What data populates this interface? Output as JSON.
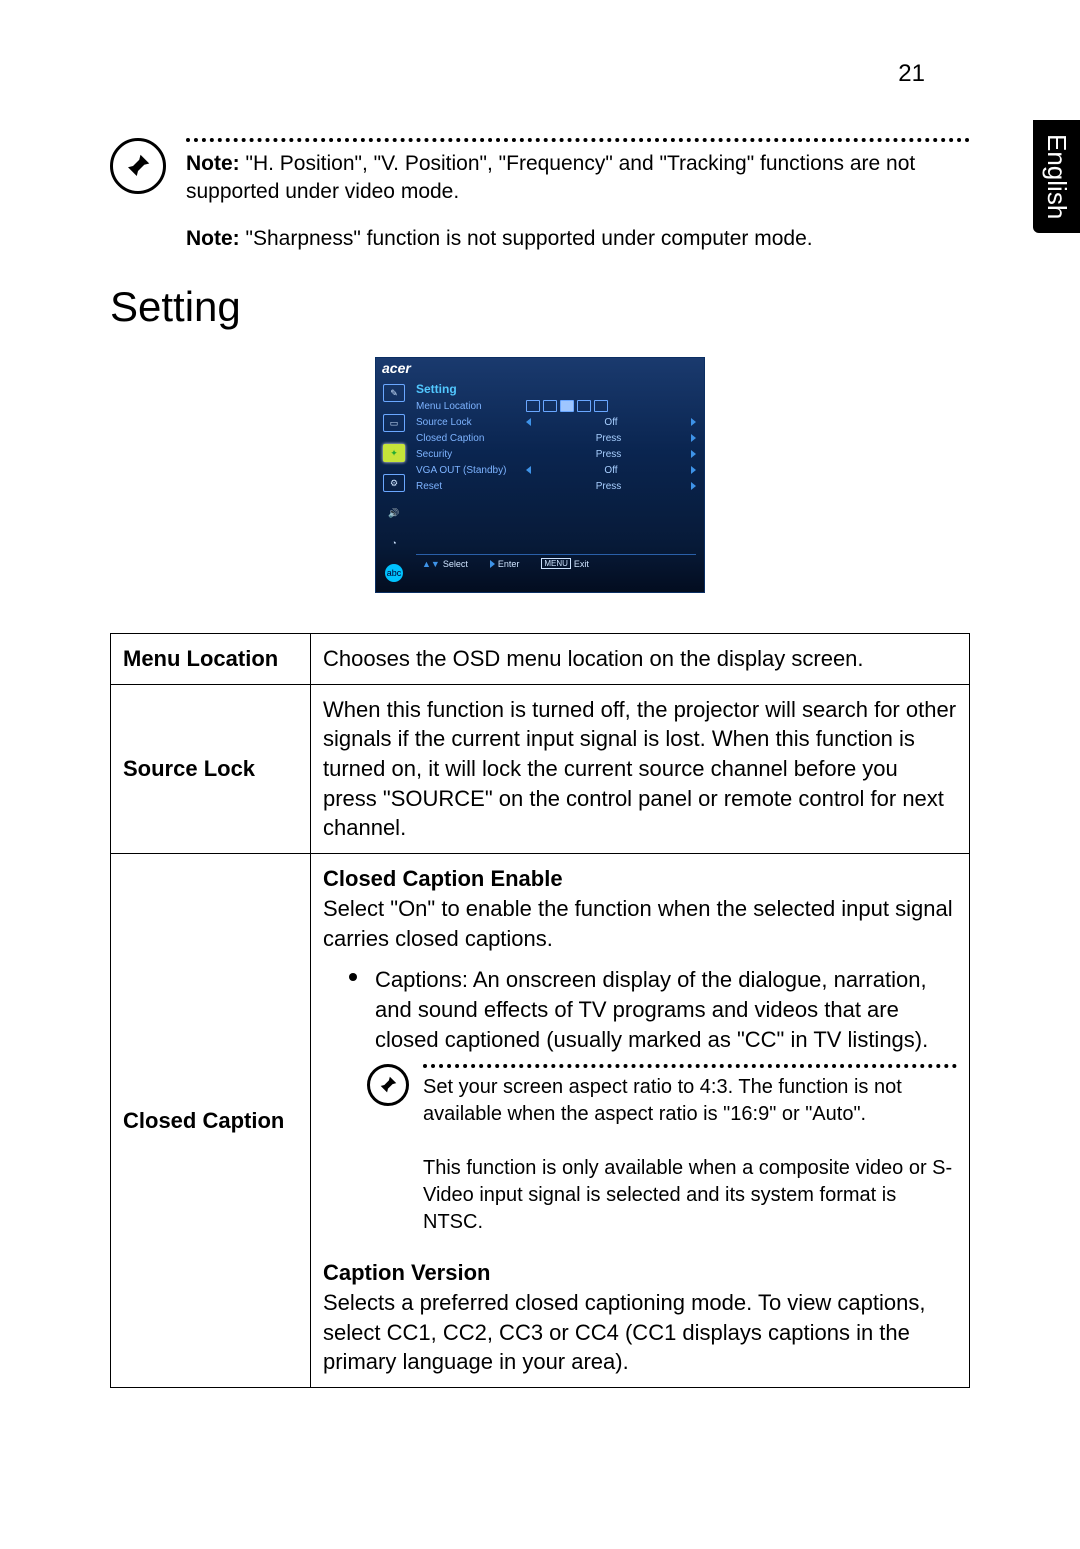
{
  "page_number": "21",
  "language_tab": "English",
  "notes": {
    "note1_bold": "Note:",
    "note1_text": " \"H. Position\", \"V. Position\", \"Frequency\" and \"Tracking\" functions are not supported under video mode.",
    "note2_bold": "Note:",
    "note2_text": " \"Sharpness\" function is not supported under computer mode."
  },
  "section_title": "Setting",
  "osd": {
    "logo": "acer",
    "heading": "Setting",
    "rows": [
      {
        "label": "Menu Location",
        "value": ""
      },
      {
        "label": "Source Lock",
        "value": "Off"
      },
      {
        "label": "Closed Caption",
        "value": "Press"
      },
      {
        "label": "Security",
        "value": "Press"
      },
      {
        "label": "VGA OUT (Standby)",
        "value": "Off"
      },
      {
        "label": "Reset",
        "value": "Press"
      }
    ],
    "footer": {
      "select": "Select",
      "enter": "Enter",
      "menu": "MENU",
      "exit": "Exit"
    }
  },
  "table": {
    "menu_location": {
      "label": "Menu Location",
      "desc": "Chooses the OSD menu location on the display screen."
    },
    "source_lock": {
      "label": "Source Lock",
      "desc": "When this function is turned off, the projector will search for other signals if the current input signal is lost. When this function is turned on, it will lock the current source channel before you press \"SOURCE\" on the control panel or remote control for next channel."
    },
    "closed_caption": {
      "label": "Closed Caption",
      "cc_enable_title": "Closed Caption Enable",
      "cc_enable_desc": "Select \"On\" to enable the function when the selected input signal carries closed captions.",
      "bullet": "Captions: An onscreen display of the dialogue, narration, and sound effects of TV programs and videos that are closed captioned (usually marked as \"CC\" in TV listings).",
      "inline_note1": "Set your screen aspect ratio to 4:3. The function is not available when the aspect ratio is \"16:9\" or \"Auto\".",
      "inline_note2": "This function is only available when a composite video or S-Video input signal is selected and its system format is NTSC.",
      "caption_version_title": "Caption Version",
      "caption_version_desc": "Selects a preferred closed captioning mode. To view captions, select CC1, CC2, CC3 or CC4 (CC1 displays captions in the primary language in your area)."
    }
  }
}
